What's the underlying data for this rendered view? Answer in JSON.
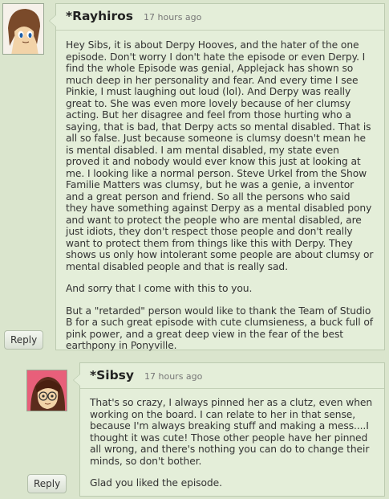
{
  "comments": [
    {
      "author": "*Rayhiros",
      "time": "17 hours ago",
      "paragraphs": [
        "Hey Sibs, it is about Derpy Hooves, and the hater of the one episode. Don't worry I don't hate the episode or even Derpy. I find the whole Episode was genial, Applejack has shown so much deep in her personality and fear. And every time I see Pinkie, I must laughing out loud (lol). And Derpy was really great to. She was even more lovely because of her clumsy acting. But her disagree and feel from those hurting who a saying, that is bad, that Derpy acts so mental disabled. That is all so false. Just because someone is clumsy doesn't mean he is mental disabled. I am mental disabled, my state even proved it and nobody would ever know this just at looking at me. I looking like a normal person. Steve Urkel from the Show Familie Matters was clumsy, but he was a genie, a inventor and a great person and friend. So all the persons who said they have something against Derpy as a mental disabled pony and want to protect the people who are mental disabled, are just idiots, they don't respect those people and don't really want to protect them from things like this with Derpy. They shows us only how intolerant some people are about clumsy or mental disabled people and that is really sad.",
        "And sorry that I come with this to you.",
        "But a \"retarded\" person would like to thank the Team of Studio B for a such great episode with cute clumsieness, a buck full of pink power, and a great deep view in the fear of the best earthpony in Ponyville."
      ],
      "reply_label": "Reply"
    },
    {
      "author": "*Sibsy",
      "time": "17 hours ago",
      "paragraphs": [
        "That's so crazy, I always pinned her as a clutz, even when working on the board. I can relate to her in that sense, because I'm always breaking stuff and making a mess....I thought it was cute! Those other people have her pinned all wrong, and there's nothing you can do to change their minds, so don't bother.",
        "Glad you liked the episode."
      ],
      "reply_label": "Reply"
    }
  ]
}
